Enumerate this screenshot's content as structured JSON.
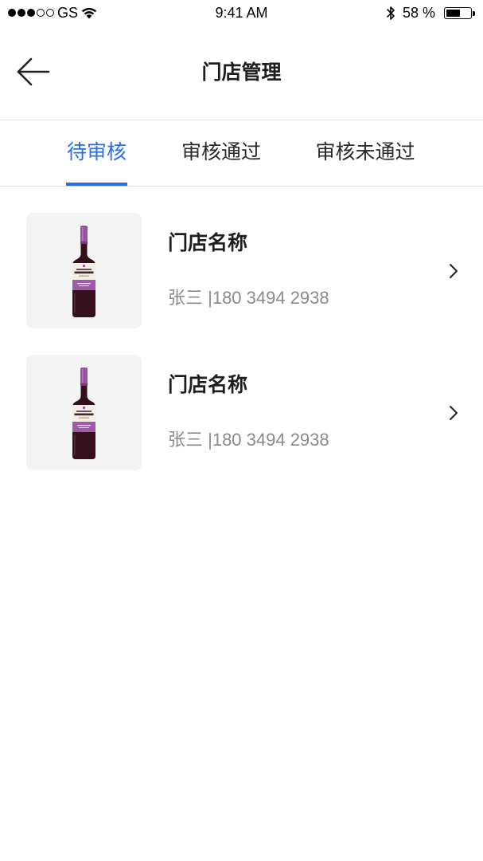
{
  "status_bar": {
    "signal_strength": 3,
    "signal_max": 5,
    "carrier": "GS",
    "wifi_icon": "wifi-icon",
    "time": "9:41 AM",
    "bluetooth_icon": "bluetooth-icon",
    "battery_text": "58 %",
    "battery_level": 0.58
  },
  "nav": {
    "back_icon": "arrow-left-icon",
    "title": "门店管理"
  },
  "tabs": [
    {
      "label": "待审核",
      "active": true
    },
    {
      "label": "审核通过",
      "active": false
    },
    {
      "label": "审核未通过",
      "active": false
    }
  ],
  "stores": [
    {
      "name": "门店名称",
      "subtitle": "张三 |180 3494 2938",
      "thumbnail_image": "wine-bottle-image",
      "chevron_icon": "chevron-right-icon"
    },
    {
      "name": "门店名称",
      "subtitle": "张三 |180 3494 2938",
      "thumbnail_image": "wine-bottle-image",
      "chevron_icon": "chevron-right-icon"
    }
  ],
  "colors": {
    "accent": "#2b6de5",
    "text": "#1e1e1e",
    "muted": "#8a8a8a",
    "thumbnail_bg": "#f4f4f4",
    "divider": "#e3e3e3"
  }
}
